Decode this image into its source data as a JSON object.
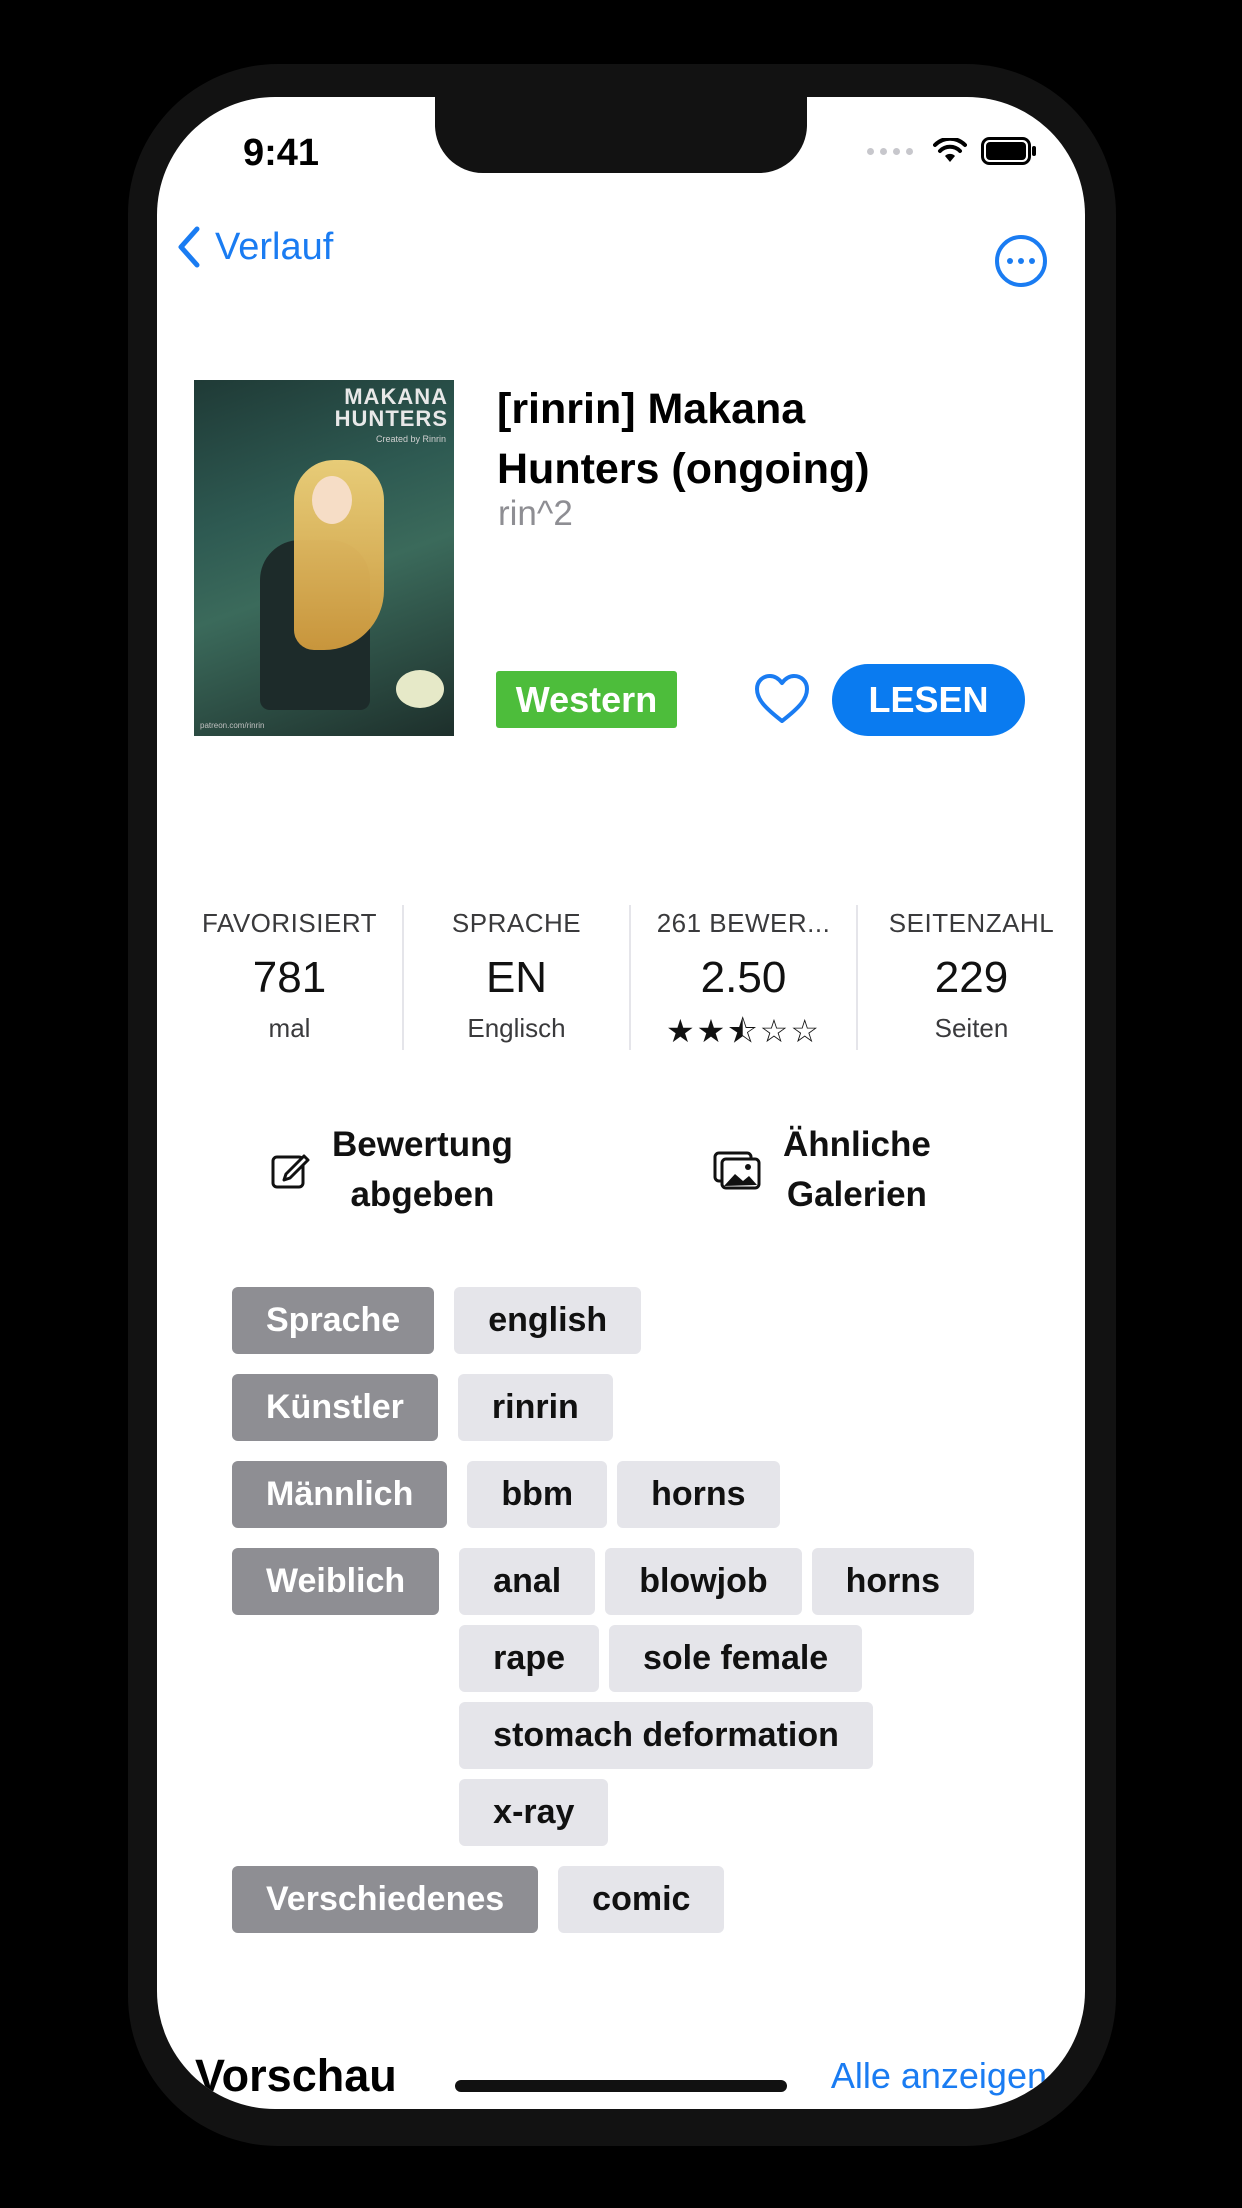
{
  "status_bar": {
    "time": "9:41"
  },
  "nav": {
    "back_label": "Verlauf"
  },
  "gallery": {
    "cover_title_line1": "MAKANA",
    "cover_title_line2": "HUNTERS",
    "cover_subtitle": "Created by Rinrin",
    "cover_footer": "patreon.com/rinrin",
    "title": "[rinrin] Makana Hunters (ongoing)",
    "artist": "rin^2",
    "category": "Western",
    "category_color": "#4dbd3b",
    "read_label": "LESEN",
    "accent_color": "#0a7bf0"
  },
  "stats": [
    {
      "label": "FAVORISIERT",
      "value": "781",
      "sub": "mal"
    },
    {
      "label": "SPRACHE",
      "value": "EN",
      "sub": "Englisch"
    },
    {
      "label": "261 BEWER...",
      "value": "2.50",
      "rating": 2.5,
      "rating_max": 5
    },
    {
      "label": "SEITENZAHL",
      "value": "229",
      "sub": "Seiten"
    }
  ],
  "actions": {
    "rate_line1": "Bewertung",
    "rate_line2": "abgeben",
    "similar_line1": "Ähnliche",
    "similar_line2": "Galerien"
  },
  "tags": [
    {
      "key": "Sprache",
      "values": [
        "english"
      ]
    },
    {
      "key": "Künstler",
      "values": [
        "rinrin"
      ]
    },
    {
      "key": "Männlich",
      "values": [
        "bbm",
        "horns"
      ]
    },
    {
      "key": "Weiblich",
      "values": [
        "anal",
        "blowjob",
        "horns",
        "rape",
        "sole female",
        "stomach deformation",
        "x-ray"
      ]
    },
    {
      "key": "Verschiedenes",
      "values": [
        "comic"
      ]
    }
  ],
  "preview": {
    "title": "Vorschau",
    "see_all": "Alle anzeigen"
  }
}
